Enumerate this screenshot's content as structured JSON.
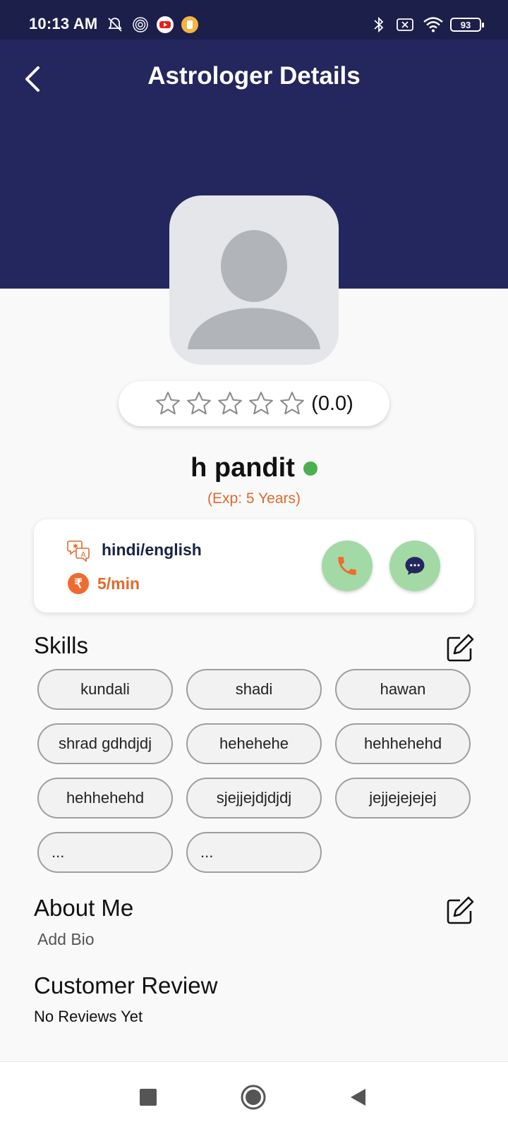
{
  "status_bar": {
    "time": "10:13 AM",
    "battery": "93",
    "icons": [
      "bell-off-icon",
      "radar-icon",
      "youtube-icon",
      "app-notification-icon",
      "bluetooth-icon",
      "no-sim-icon",
      "wifi-icon",
      "battery-icon"
    ]
  },
  "header": {
    "title": "Astrologer Details",
    "back_icon": "chevron-left-icon"
  },
  "rating": {
    "stars": 0,
    "max_stars": 5,
    "value_text": "(0.0)"
  },
  "profile": {
    "name": "h pandit",
    "online": true,
    "experience": "(Exp: 5 Years)"
  },
  "info_card": {
    "language": "hindi/english",
    "price": "5/min",
    "call_icon": "phone-icon",
    "chat_icon": "chat-bubble-icon"
  },
  "skills": {
    "title": "Skills",
    "edit_icon": "edit-icon",
    "items": [
      "kundali",
      "shadi",
      "hawan",
      "shrad gdhdjdj",
      "hehehehe",
      "hehhehehd",
      "hehhehehd",
      "sjejjejdjdjdj",
      "jejjejejejej",
      "...",
      "..."
    ]
  },
  "about": {
    "title": "About Me",
    "bio_placeholder": "Add Bio",
    "edit_icon": "edit-icon"
  },
  "reviews": {
    "title": "Customer Review",
    "empty_text": "No Reviews Yet"
  },
  "colors": {
    "header_bg": "#24275e",
    "status_bg": "#1c1f4a",
    "accent_orange": "#e06a2b",
    "online_green": "#4caf50",
    "action_green": "#a3d9a5"
  }
}
